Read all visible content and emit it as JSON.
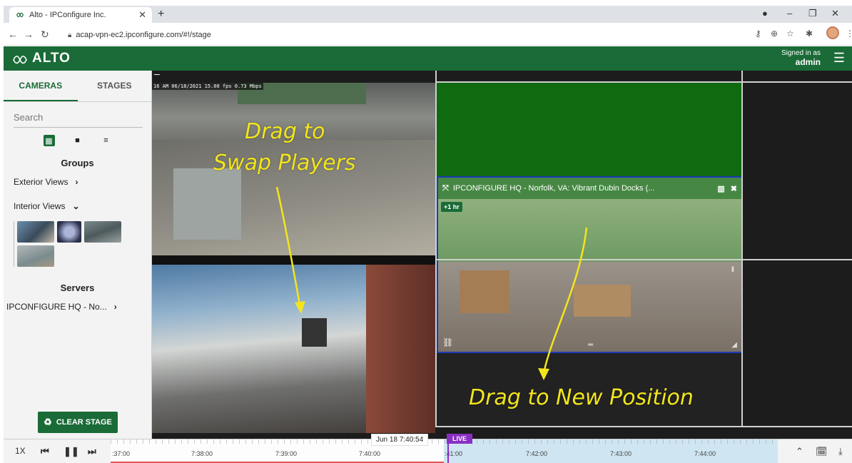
{
  "browser": {
    "tab_title": "Alto - IPConfigure Inc.",
    "url": "acap-vpn-ec2.ipconfigure.com/#!/stage"
  },
  "app": {
    "logo_text": "ALTO",
    "signed_in_label": "Signed in as",
    "username": "admin"
  },
  "sidebar": {
    "tabs": [
      "CAMERAS",
      "STAGES"
    ],
    "search_placeholder": "Search",
    "groups_title": "Groups",
    "groups": [
      {
        "label": "Exterior Views",
        "chevron": "›"
      },
      {
        "label": "Interior Views",
        "chevron": "⌄"
      }
    ],
    "servers_title": "Servers",
    "server": "IPCONFIGURE HQ - No...",
    "clear_stage_label": "CLEAR STAGE"
  },
  "stage": {
    "camera_overlay": "16 AM 06/18/2021 15.00 fps  0.73 Mbps",
    "floating_player_title": "IPCONFIGURE HQ - Norfolk, VA: Vibrant Dubin Docks (...",
    "floating_badge": "+1 hr",
    "annotation_swap": "Drag to\nSwap Players",
    "annotation_swap_line1": "Drag to",
    "annotation_swap_line2": "Swap Players",
    "annotation_move": "Drag to New Position"
  },
  "timeline": {
    "speed": "1X",
    "current_time": "Jun 18 7:40:54",
    "live_label": "LIVE",
    "labels": [
      ":37:00",
      "7:38:00",
      "7:39:00",
      "7:40:00",
      ":41:00",
      "7:42:00",
      "7:43:00",
      "7:44:00"
    ]
  },
  "colors": {
    "brand_green": "#1a6b37",
    "drop_zone_green": "#0f6a10",
    "annotation_yellow": "#f2e51c",
    "live_purple": "#8a2fc4"
  }
}
